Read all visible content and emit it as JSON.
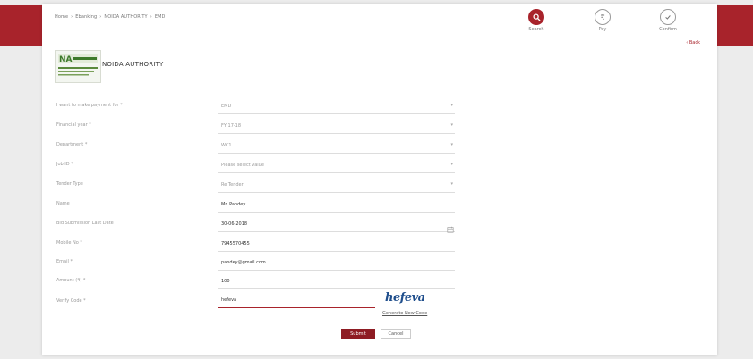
{
  "breadcrumb": [
    "Home",
    "Ebanking",
    "NOIDA AUTHORITY",
    "EMD"
  ],
  "steps": [
    {
      "label": "Search",
      "active": true
    },
    {
      "label": "Pay",
      "active": false
    },
    {
      "label": "Confirm",
      "active": false
    }
  ],
  "back_label": "‹ Back",
  "org": {
    "name": "NOIDA AUTHORITY"
  },
  "form": {
    "payment_for": {
      "label": "I want to make payment for *",
      "value": "EMD"
    },
    "financial_year": {
      "label": "Financial year *",
      "value": "FY 17-18"
    },
    "department": {
      "label": "Department *",
      "value": "WC1"
    },
    "job_id": {
      "label": "Job ID *",
      "value": "Please select value"
    },
    "tender_type": {
      "label": "Tender Type",
      "value": "Re Tender"
    },
    "name": {
      "label": "Name",
      "value": "Mr. Pandey"
    },
    "bid_date": {
      "label": "Bid Submission Last Date",
      "value": "30-06-2018"
    },
    "mobile": {
      "label": "Mobile No *",
      "value": "7945570455"
    },
    "email": {
      "label": "Email *",
      "value": "pandey@gmail.com"
    },
    "amount": {
      "label": "Amount (₹) *",
      "value": "100"
    },
    "verify_code": {
      "label": "Verify Code *",
      "value": "hefeva"
    }
  },
  "captcha": {
    "text": "hefeva",
    "regenerate_label": "Generate New Code"
  },
  "buttons": {
    "submit": "Submit",
    "cancel": "Cancel"
  },
  "colors": {
    "brand": "#a8232b",
    "submit": "#8e1c23"
  }
}
